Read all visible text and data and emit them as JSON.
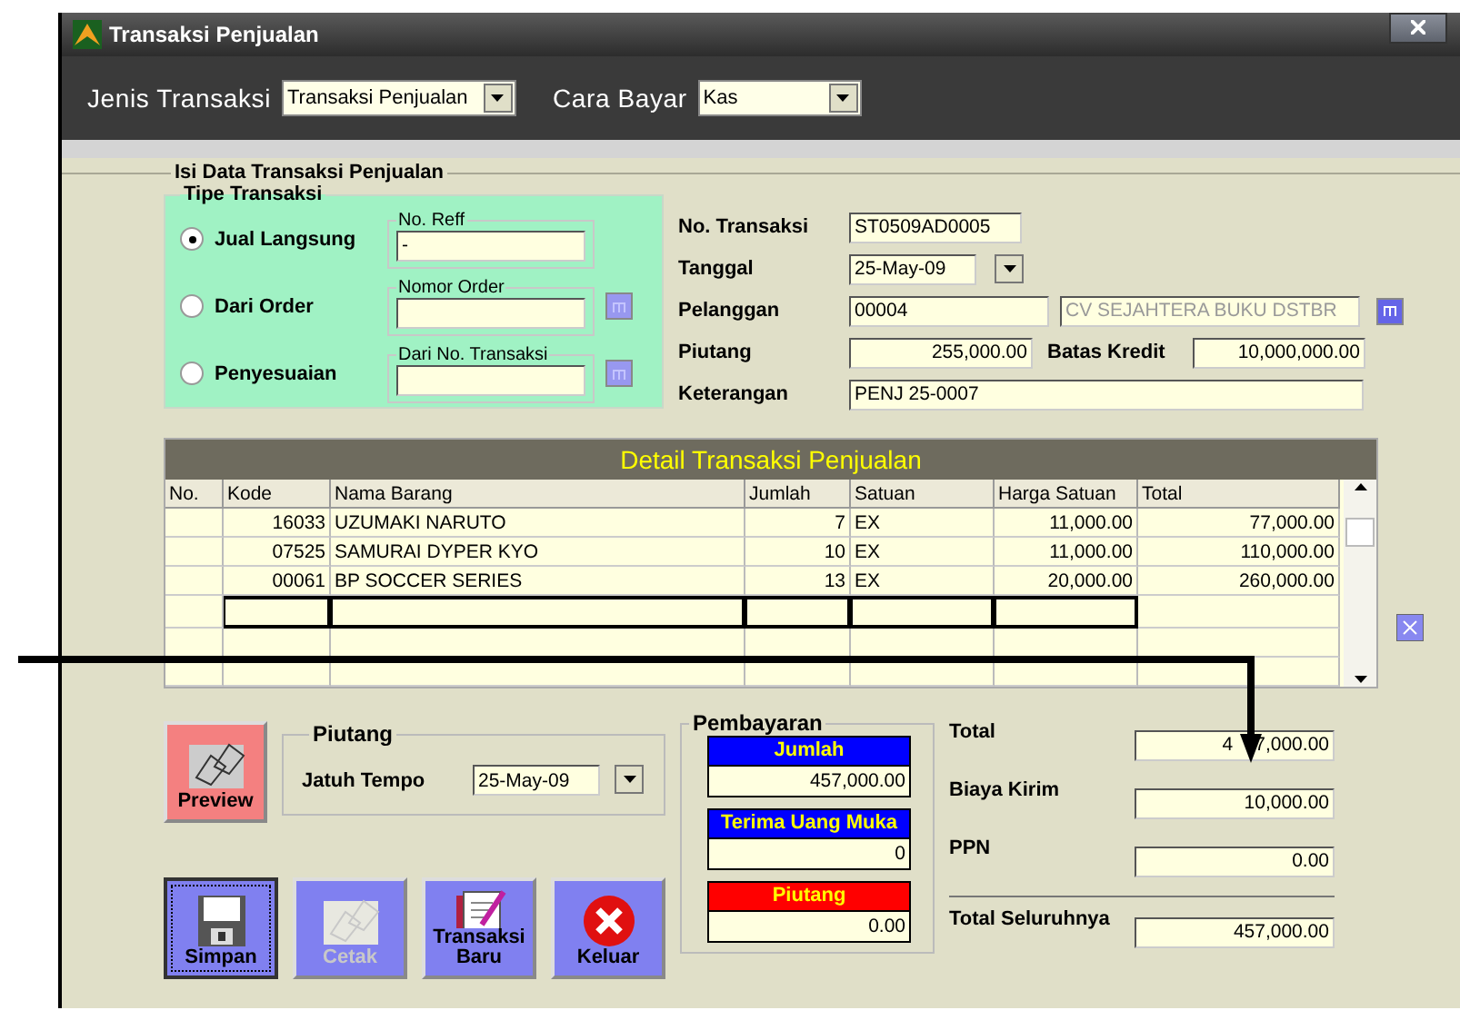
{
  "window": {
    "title": "Transaksi Penjualan"
  },
  "header": {
    "jenis_label": "Jenis Transaksi",
    "jenis_value": "Transaksi Penjualan",
    "cara_label": "Cara Bayar",
    "cara_value": "Kas"
  },
  "data_group": {
    "title": "Isi Data Transaksi Penjualan"
  },
  "tipe": {
    "title": "Tipe Transaksi",
    "options": [
      {
        "label": "Jual Langsung",
        "selected": true,
        "field_label": "No. Reff",
        "field_value": "-",
        "lookup": false
      },
      {
        "label": "Dari Order",
        "selected": false,
        "field_label": "Nomor Order",
        "lookup": true
      },
      {
        "label": "Penyesuaian",
        "selected": false,
        "field_label": "Dari  No. Transaksi",
        "lookup": true
      }
    ]
  },
  "form": {
    "no_transaksi_label": "No. Transaksi",
    "no_transaksi": "ST0509AD0005",
    "tanggal_label": "Tanggal",
    "tanggal": "25-May-09",
    "pelanggan_label": "Pelanggan",
    "pelanggan_kode": "00004",
    "pelanggan_nama": "CV SEJAHTERA BUKU DSTBR",
    "piutang_label": "Piutang",
    "piutang": "255,000.00",
    "batas_label": "Batas Kredit",
    "batas": "10,000,000.00",
    "keterangan_label": "Keterangan",
    "keterangan": "PENJ 25-0007"
  },
  "table": {
    "title": "Detail Transaksi Penjualan",
    "columns": [
      "No.",
      "Kode",
      "Nama Barang",
      "Jumlah",
      "Satuan",
      "Harga Satuan",
      "Total"
    ],
    "rows": [
      {
        "kode": "16033",
        "nama": "UZUMAKI NARUTO",
        "jumlah": "7",
        "satuan": "EX",
        "harga": "11,000.00",
        "total": "77,000.00"
      },
      {
        "kode": "07525",
        "nama": "SAMURAI DYPER KYO",
        "jumlah": "10",
        "satuan": "EX",
        "harga": "11,000.00",
        "total": "110,000.00"
      },
      {
        "kode": "00061",
        "nama": "BP SOCCER SERIES",
        "jumlah": "13",
        "satuan": "EX",
        "harga": "20,000.00",
        "total": "260,000.00"
      }
    ]
  },
  "preview": {
    "label": "Preview"
  },
  "piutang_group": {
    "title": "Piutang",
    "label": "Jatuh Tempo",
    "value": "25-May-09"
  },
  "pembayaran": {
    "title": "Pembayaran",
    "boxes": [
      {
        "label": "Jumlah",
        "value": "457,000.00",
        "color": "#0000ff"
      },
      {
        "label": "Terima Uang Muka",
        "value": "0",
        "color": "#0000ff"
      },
      {
        "label": "Piutang",
        "value": "0.00",
        "color": "#ff0000"
      }
    ]
  },
  "totals": [
    {
      "label": "Total",
      "value_lead": "4",
      "value": "7,000.00",
      "kind": "line"
    },
    {
      "label": "Biaya Kirim",
      "value": "10,000.00",
      "kind": "line"
    },
    {
      "label": "PPN",
      "value": "0.00",
      "kind": "line"
    },
    {
      "label": "Total Seluruhnya",
      "value": "457,000.00",
      "kind": "grand"
    }
  ],
  "buttons": [
    {
      "label": "Simpan",
      "kind": "save",
      "disabled": false,
      "focused": true
    },
    {
      "label": "Cetak",
      "kind": "print",
      "disabled": true,
      "focused": false
    },
    {
      "label": "Transaksi Baru",
      "kind": "new",
      "disabled": false,
      "focused": false
    },
    {
      "label": "Keluar",
      "kind": "exit",
      "disabled": false,
      "focused": false
    }
  ]
}
